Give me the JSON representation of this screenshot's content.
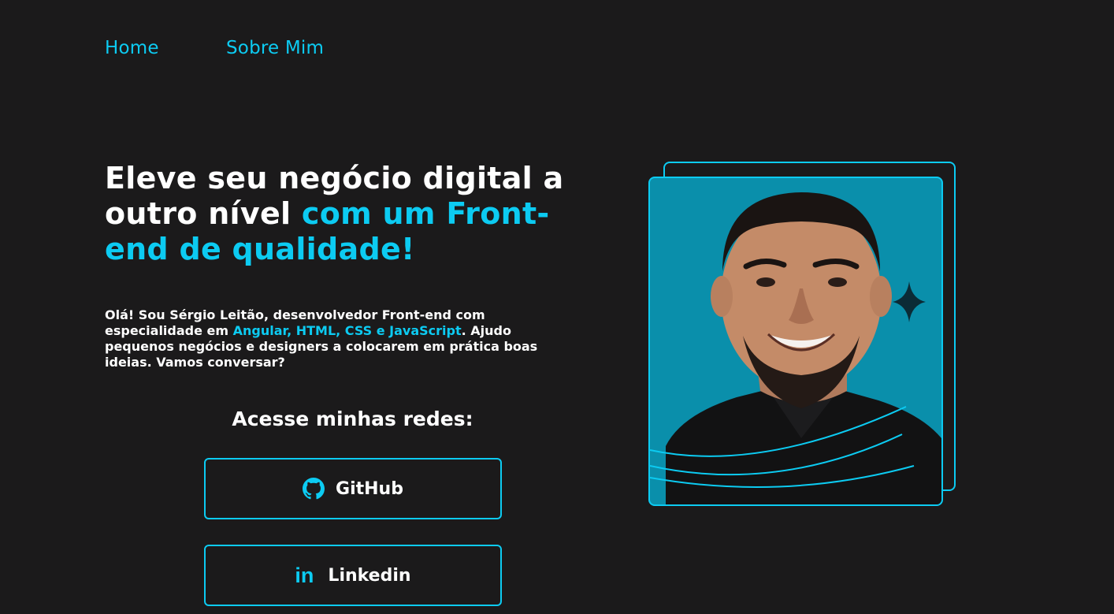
{
  "nav": {
    "home": "Home",
    "about": "Sobre Mim"
  },
  "hero": {
    "headline_white": "Eleve seu negócio digital a outro nível",
    "headline_accent": "com um Front-end de qualidade!",
    "intro_part1": "Olá! Sou Sérgio Leitão, desenvolvedor Front-end com especialidade em",
    "intro_highlight": "Angular, HTML, CSS e JavaScript",
    "intro_part2": ". Ajudo pequenos negócios e designers a colocarem em prática boas ideias. Vamos conversar?"
  },
  "social": {
    "title": "Acesse minhas redes:",
    "github_label": "GitHub",
    "linkedin_label": "Linkedin",
    "linkedin_glyph": "in"
  },
  "icons": {
    "github": "github-icon",
    "linkedin": "linkedin-icon",
    "sparkle": "sparkle-icon"
  },
  "colors": {
    "background": "#1b1a1b",
    "accent": "#0ccbf2",
    "photo_bg": "#0a8fab",
    "text": "#ffffff"
  }
}
